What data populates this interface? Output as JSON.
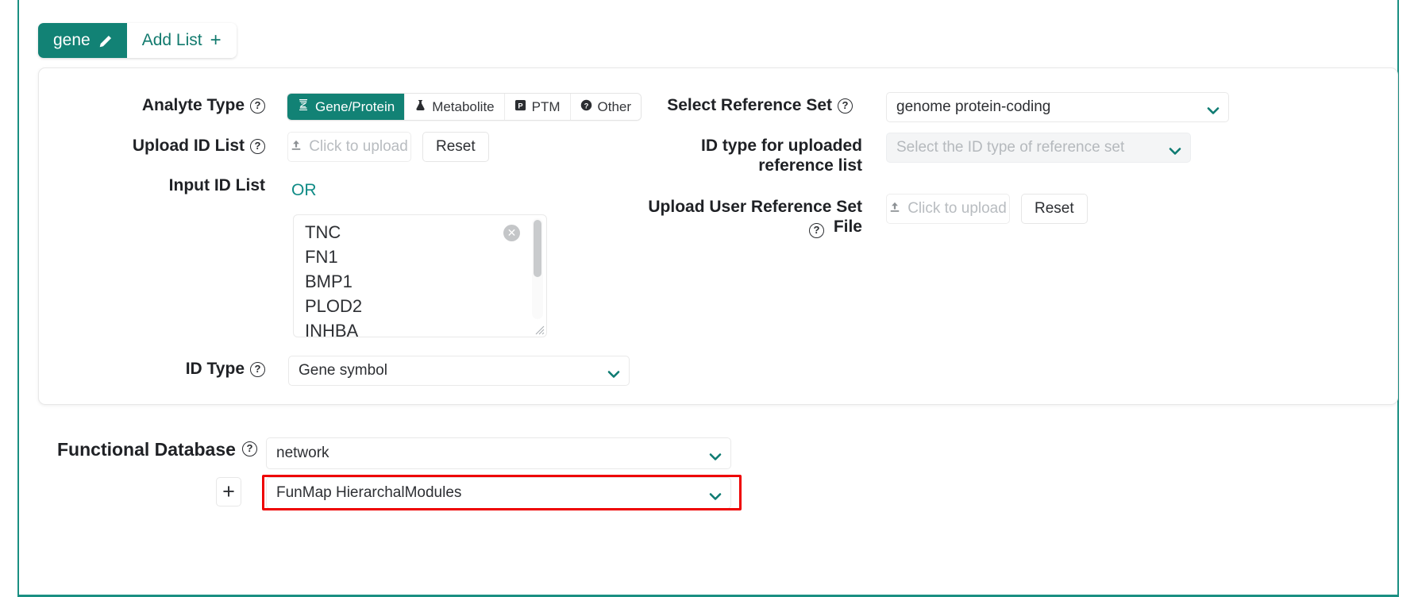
{
  "tabs": [
    {
      "label": "gene",
      "icon": "pencil-icon",
      "active": true
    },
    {
      "label": "Add List",
      "icon": "plus-icon",
      "active": false
    }
  ],
  "form": {
    "analyte_type": {
      "label": "Analyte Type",
      "help": "?",
      "options": [
        {
          "label": "Gene/Protein",
          "icon": "dna-icon",
          "selected": true
        },
        {
          "label": "Metabolite",
          "icon": "flask-icon",
          "selected": false
        },
        {
          "label": "PTM",
          "icon": "p-square-icon",
          "selected": false
        },
        {
          "label": "Other",
          "icon": "question-circle-icon",
          "selected": false
        }
      ]
    },
    "upload_id_list": {
      "label": "Upload ID List",
      "help": "?",
      "upload_text": "Click to upload",
      "reset_label": "Reset"
    },
    "input_id_list": {
      "label": "Input ID List",
      "or_text": "OR",
      "textarea_value": "TNC\nFN1\nBMP1\nPLOD2\nINHBA",
      "clear_icon": "clear-circle-icon"
    },
    "id_type": {
      "label": "ID Type",
      "help": "?",
      "value": "Gene symbol"
    },
    "reference_set": {
      "label": "Select Reference Set",
      "help": "?",
      "value": "genome protein-coding"
    },
    "id_type_uploaded": {
      "label": "ID type for uploaded reference list",
      "placeholder": "Select the ID type of reference set"
    },
    "upload_user_reference": {
      "label": "Upload User Reference Set File",
      "help": "?",
      "upload_text": "Click to upload",
      "reset_label": "Reset"
    },
    "functional_database": {
      "label": "Functional Database",
      "help": "?",
      "value": "network",
      "add_icon": "plus-icon",
      "sub_value": "FunMap HierarchalModules",
      "highlighted": true
    }
  },
  "colors": {
    "accent": "#128275",
    "highlight": "#ee0000",
    "text": "#1f2125",
    "muted": "#b5b9bd"
  }
}
